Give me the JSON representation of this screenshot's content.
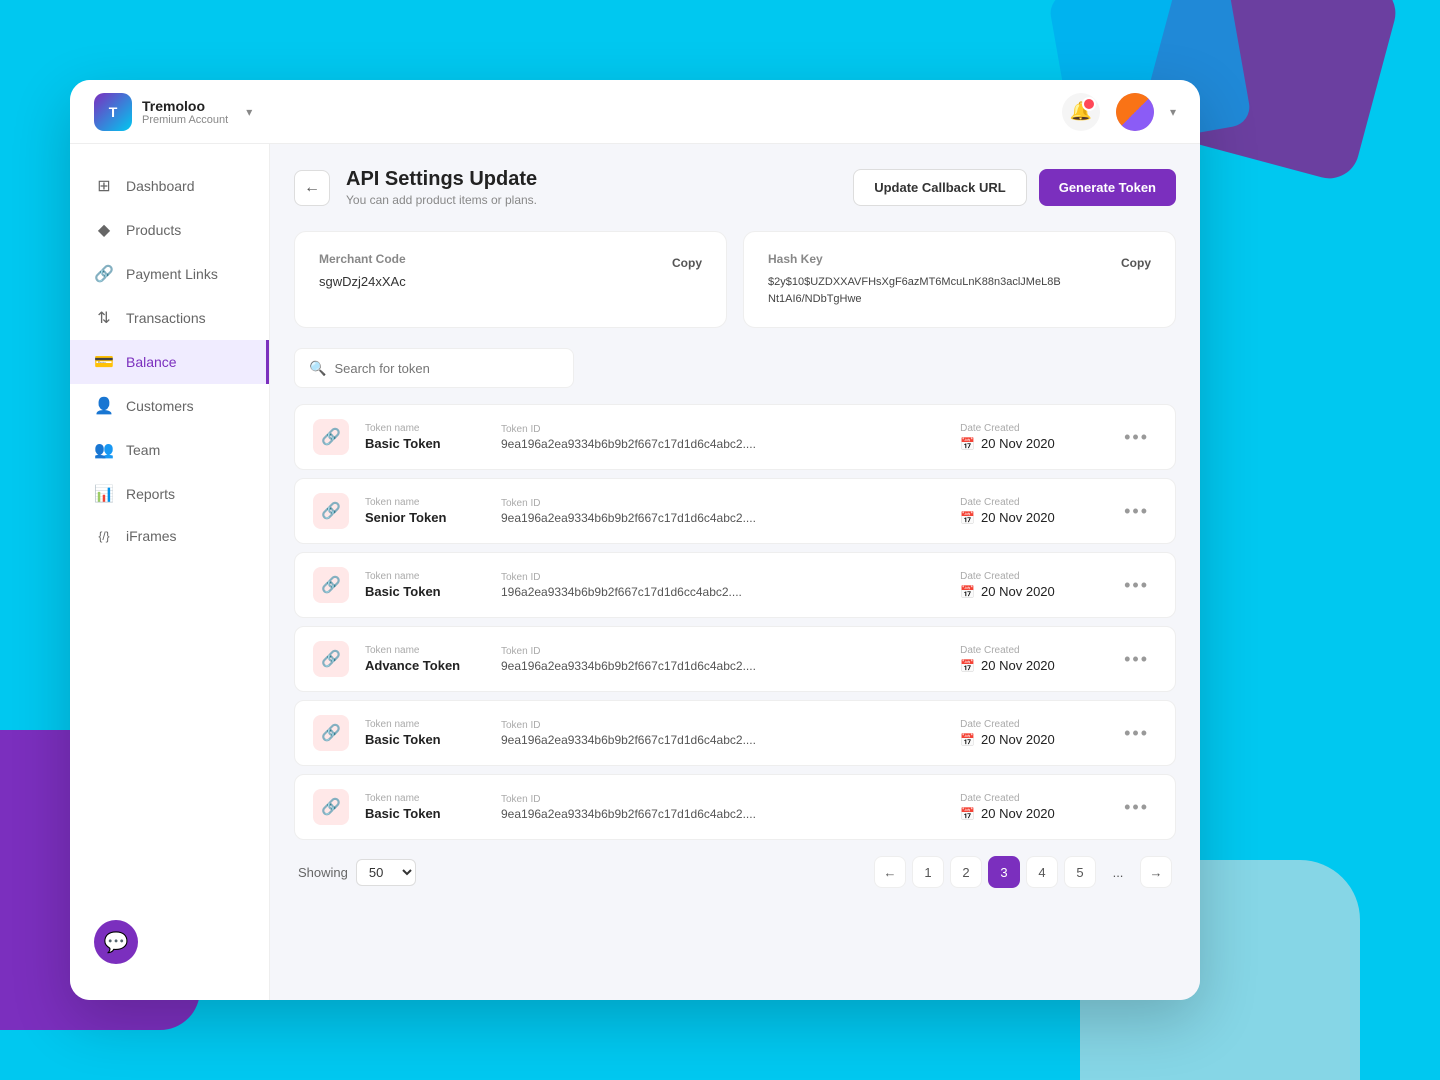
{
  "app": {
    "name": "Tremoloo",
    "account_type": "Premium Account"
  },
  "header": {
    "back_label": "←",
    "title": "API Settings Update",
    "subtitle": "You can add product items or plans.",
    "update_callback_url": "Update Callback URL",
    "generate_token": "Generate Token"
  },
  "merchant_card": {
    "label": "Merchant Code",
    "value": "sgwDzj24xXAc",
    "copy_label": "Copy"
  },
  "hash_card": {
    "label": "Hash Key",
    "value": "$2y$10$UZDXXAVFHsXgF6azMT6McuLnK88n3aclJMeL8BNt1AI6/NDbTgHwe",
    "copy_label": "Copy"
  },
  "search": {
    "placeholder": "Search for token"
  },
  "tokens": [
    {
      "token_name_label": "Token name",
      "token_name": "Basic Token",
      "token_id_label": "Token ID",
      "token_id": "9ea196a2ea9334b6b9b2f667c17d1d6c4abc2....",
      "date_label": "Date Created",
      "date": "20 Nov 2020"
    },
    {
      "token_name_label": "Token name",
      "token_name": "Senior Token",
      "token_id_label": "Token ID",
      "token_id": "9ea196a2ea9334b6b9b2f667c17d1d6c4abc2....",
      "date_label": "Date Created",
      "date": "20 Nov 2020"
    },
    {
      "token_name_label": "Token name",
      "token_name": "Basic Token",
      "token_id_label": "Token ID",
      "token_id": "196a2ea9334b6b9b2f667c17d1d6cc4abc2....",
      "date_label": "Date Created",
      "date": "20 Nov 2020"
    },
    {
      "token_name_label": "Token name",
      "token_name": "Advance Token",
      "token_id_label": "Token ID",
      "token_id": "9ea196a2ea9334b6b9b2f667c17d1d6c4abc2....",
      "date_label": "Date Created",
      "date": "20 Nov 2020"
    },
    {
      "token_name_label": "Token name",
      "token_name": "Basic Token",
      "token_id_label": "Token ID",
      "token_id": "9ea196a2ea9334b6b9b2f667c17d1d6c4abc2....",
      "date_label": "Date Created",
      "date": "20 Nov 2020"
    },
    {
      "token_name_label": "Token name",
      "token_name": "Basic Token",
      "token_id_label": "Token ID",
      "token_id": "9ea196a2ea9334b6b9b2f667c17d1d6c4abc2....",
      "date_label": "Date Created",
      "date": "20 Nov 2020"
    }
  ],
  "pagination": {
    "showing_label": "Showing",
    "page_size": "50",
    "pages": [
      "1",
      "2",
      "3",
      "4",
      "5",
      "..."
    ],
    "current_page": "3"
  },
  "sidebar": {
    "items": [
      {
        "label": "Dashboard",
        "icon": "⊞",
        "active": false
      },
      {
        "label": "Products",
        "icon": "◆",
        "active": false
      },
      {
        "label": "Payment Links",
        "icon": "🔗",
        "active": false
      },
      {
        "label": "Transactions",
        "icon": "⇅",
        "active": false
      },
      {
        "label": "Balance",
        "icon": "💳",
        "active": true
      },
      {
        "label": "Customers",
        "icon": "👤",
        "active": false
      },
      {
        "label": "Team",
        "icon": "👥",
        "active": false
      },
      {
        "label": "Reports",
        "icon": "📊",
        "active": false
      },
      {
        "label": "iFrames",
        "icon": "{/}",
        "active": false
      }
    ]
  }
}
